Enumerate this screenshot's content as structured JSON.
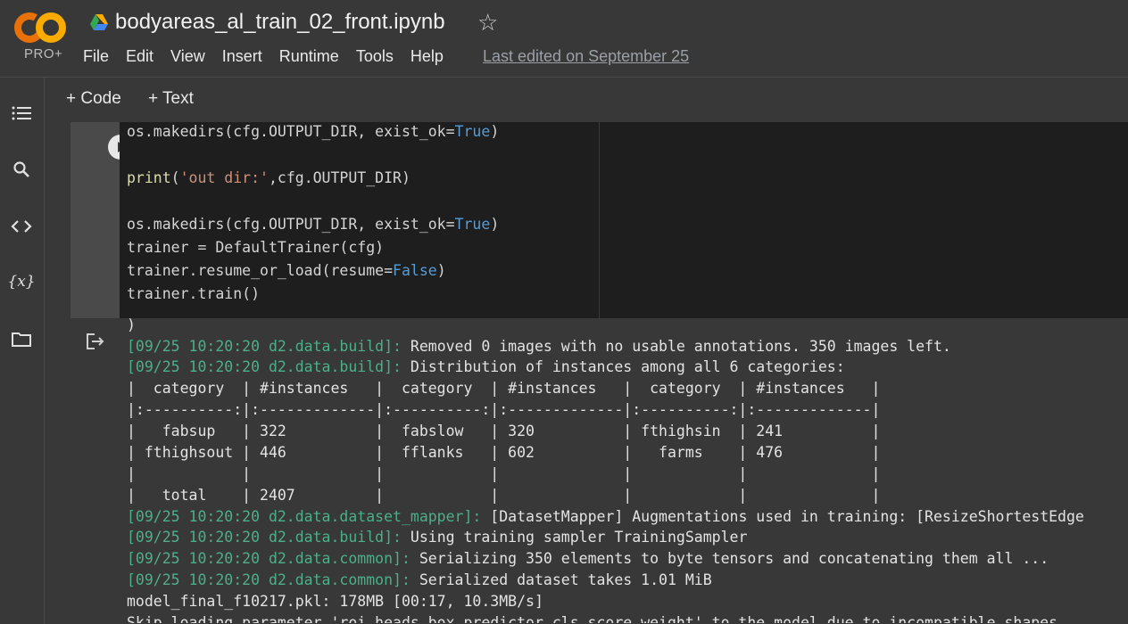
{
  "header": {
    "logo_text": "CO",
    "pro_label": "PRO+",
    "title": "bodyareas_al_train_02_front.ipynb",
    "star_glyph": "☆",
    "menu": [
      "File",
      "Edit",
      "View",
      "Insert",
      "Runtime",
      "Tools",
      "Help"
    ],
    "last_edited": "Last edited on September 25"
  },
  "sidebar": {
    "icons": [
      "table-of-contents-icon",
      "search-icon",
      "code-snippets-icon",
      "variables-icon",
      "folder-icon"
    ]
  },
  "toolbar": {
    "code_label": "+ Code",
    "text_label": "+ Text"
  },
  "code_cell": {
    "lines": [
      "os.makedirs(cfg.OUTPUT_DIR, exist_ok=True)",
      "",
      "print('out dir:',cfg.OUTPUT_DIR)",
      "",
      "os.makedirs(cfg.OUTPUT_DIR, exist_ok=True)",
      "trainer = DefaultTrainer(cfg)",
      "trainer.resume_or_load(resume=False)",
      "trainer.train()"
    ]
  },
  "output": {
    "lines": [
      {
        "prefix": "",
        "text": ")"
      },
      {
        "prefix": "[09/25 10:20:20 d2.data.build]:",
        "text": " Removed 0 images with no usable annotations. 350 images left."
      },
      {
        "prefix": "[09/25 10:20:20 d2.data.build]:",
        "text": " Distribution of instances among all 6 categories:"
      },
      {
        "prefix": "",
        "text": "|  category  | #instances   |  category  | #instances   |  category  | #instances   |"
      },
      {
        "prefix": "",
        "text": "|:----------:|:-------------|:----------:|:-------------|:----------:|:-------------|"
      },
      {
        "prefix": "",
        "text": "|   fabsup   | 322          |  fabslow   | 320          | fthighsin  | 241          |"
      },
      {
        "prefix": "",
        "text": "| fthighsout | 446          |  fflanks   | 602          |   farms    | 476          |"
      },
      {
        "prefix": "",
        "text": "|            |              |            |              |            |              |"
      },
      {
        "prefix": "",
        "text": "|   total    | 2407         |            |              |            |              |"
      },
      {
        "prefix": "[09/25 10:20:20 d2.data.dataset_mapper]:",
        "text": " [DatasetMapper] Augmentations used in training: [ResizeShortestEdge"
      },
      {
        "prefix": "[09/25 10:20:20 d2.data.build]:",
        "text": " Using training sampler TrainingSampler"
      },
      {
        "prefix": "[09/25 10:20:20 d2.data.common]:",
        "text": " Serializing 350 elements to byte tensors and concatenating them all ..."
      },
      {
        "prefix": "[09/25 10:20:20 d2.data.common]:",
        "text": " Serialized dataset takes 1.01 MiB"
      },
      {
        "prefix": "",
        "text": "model_final_f10217.pkl: 178MB [00:17, 10.3MB/s]"
      },
      {
        "prefix": "",
        "text": "Skip loading parameter 'roi_heads.box_predictor.cls_score.weight' to the model due to incompatible shapes"
      }
    ]
  },
  "colors": {
    "background": "#383838",
    "code_bg": "#1e1e1e",
    "keyword": "#569cd6",
    "string": "#ce9178",
    "log_prefix": "#4caf8a",
    "logo_orange": "#f9ab00",
    "logo_dark_orange": "#e8710a"
  }
}
